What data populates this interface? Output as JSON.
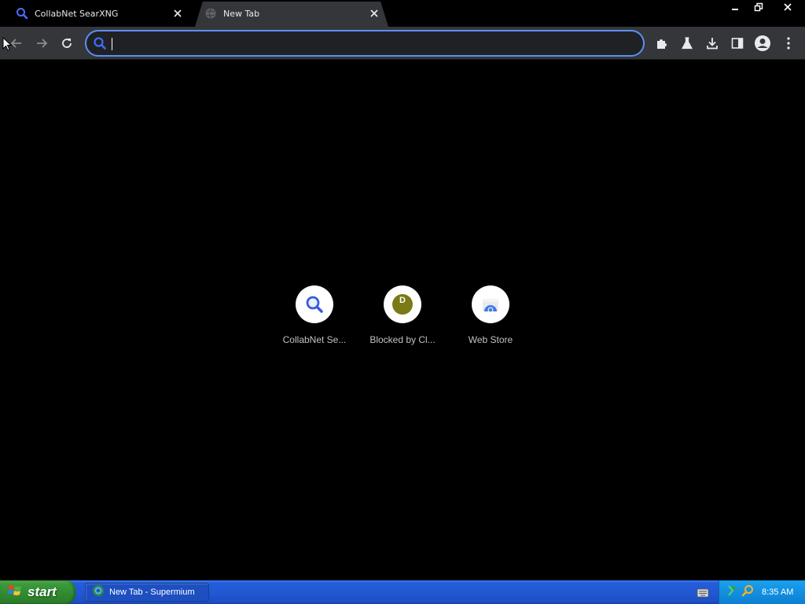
{
  "tabs": [
    {
      "title": "CollabNet SearXNG",
      "active": false,
      "icon": "search-icon"
    },
    {
      "title": "New Tab",
      "active": true,
      "icon": "globe-icon"
    }
  ],
  "omnibox": {
    "value": "",
    "placeholder": ""
  },
  "shortcuts": [
    {
      "label": "CollabNet Se...",
      "icon": "search-icon"
    },
    {
      "label": "Blocked by Cl...",
      "icon": "letter-d-icon",
      "letter": "D"
    },
    {
      "label": "Web Store",
      "icon": "web-store-icon"
    }
  ],
  "taskbar": {
    "start_label": "start",
    "task_label": "New Tab - Supermium",
    "clock": "8:35 AM"
  },
  "colors": {
    "accent": "#5b8ff4",
    "tab_active": "#35363a",
    "toolbar": "#35363a",
    "taskbar_blue": "#245edb",
    "start_green": "#3c9a3c"
  }
}
